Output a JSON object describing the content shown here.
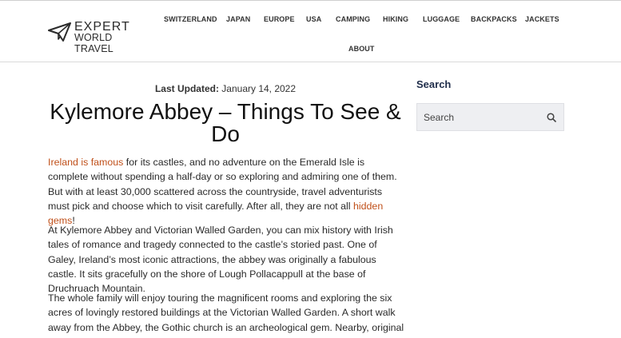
{
  "site": {
    "logo_line1": "EXPERT",
    "logo_line2": "WORLD TRAVEL"
  },
  "nav": {
    "items": [
      "SWITZERLAND",
      "JAPAN",
      "EUROPE",
      "USA",
      "CAMPING",
      "HIKING",
      "LUGGAGE",
      "BACKPACKS",
      "JACKETS",
      "ABOUT"
    ]
  },
  "article": {
    "updated_label": "Last Updated:",
    "updated_date": "January 14, 2022",
    "title": "Kylemore Abbey – Things To See & Do",
    "p1_link1": "Ireland is famous",
    "p1_text1": " for its castles, and no adventure on the Emerald Isle is complete without spending a half-day or so exploring and admiring one of them. But with at least 30,000 scattered across the countryside, travel adventurists must pick and choose which to visit carefully. After all, they are not all ",
    "p1_link2": "hidden gems",
    "p1_text2": "!",
    "p2": "At Kylemore Abbey and Victorian Walled Garden, you can mix history with Irish tales of romance and tragedy connected to the castle’s storied past. One of Galey, Ireland’s most iconic attractions, the abbey was originally a fabulous castle. It sits gracefully on the shore of Lough Pollacappull at the base of Druchruach Mountain.",
    "p3": "The whole family will enjoy touring the magnificent rooms and exploring the six acres of lovingly restored buildings at the Victorian Walled Garden. A short walk away from the Abbey, the Gothic church is an archeological gem. Nearby, original"
  },
  "sidebar": {
    "title": "Search",
    "search_placeholder": "Search"
  },
  "colors": {
    "link": "#c0501a",
    "sidebar_heading": "#1f2d4a"
  }
}
